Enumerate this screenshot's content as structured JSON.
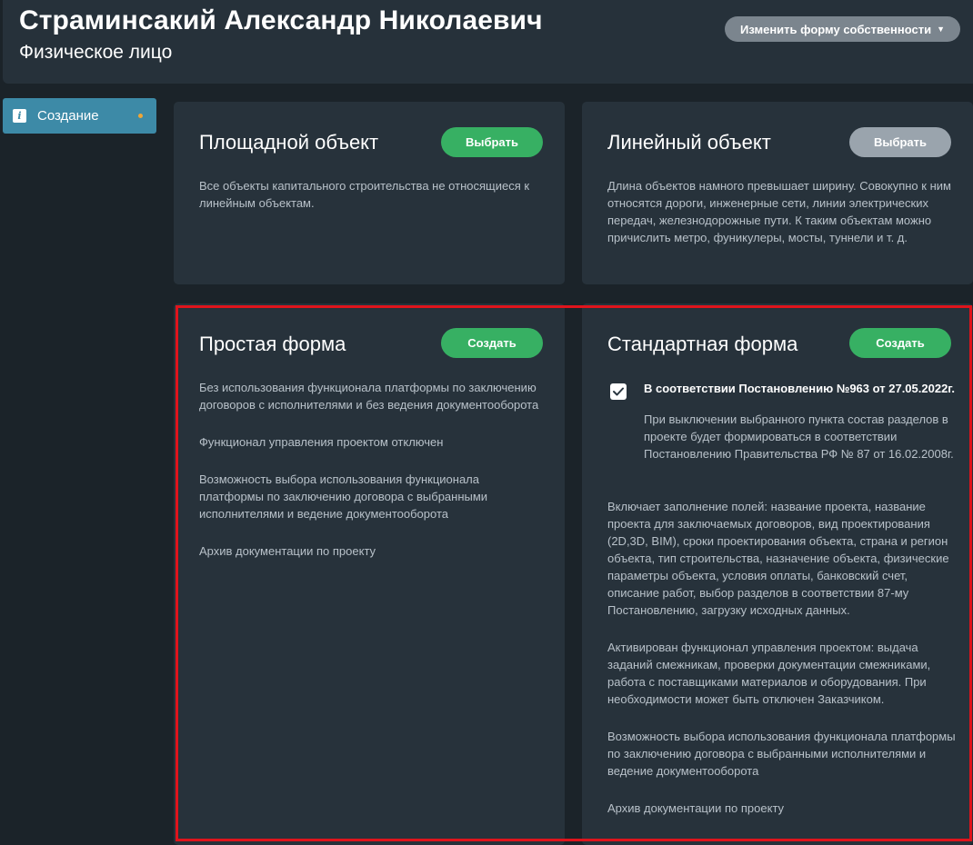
{
  "header": {
    "title": "Страминсакий Александр Николаевич",
    "subtitle": "Физическое лицо",
    "owner_button": "Изменить форму собственности"
  },
  "sidebar": {
    "items": [
      {
        "label": "Создание",
        "icon": "info-icon"
      }
    ]
  },
  "object_types": [
    {
      "title": "Площадной объект",
      "button": "Выбрать",
      "description": "Все объекты капитального строительства не относящиеся к линейным объектам."
    },
    {
      "title": "Линейный объект",
      "button": "Выбрать",
      "description": "Длина объектов намного превышает ширину. Совокупно к ним относятся дороги, инженерные сети, линии электрических передач, железнодорожные пути. К таким объектам можно причислить метро, фуникулеры, мосты, туннели и т. д."
    }
  ],
  "forms": {
    "simple": {
      "title": "Простая форма",
      "button": "Создать",
      "paragraphs": [
        "Без использования функционала платформы по заключению договоров с исполнителями и без ведения документооборота",
        "Функционал управления проектом отключен",
        "Возможность выбора использования функционала платформы по заключению договора с выбранными исполнителями и ведение документооборота",
        "Архив документации по проекту"
      ]
    },
    "standard": {
      "title": "Стандартная форма",
      "button": "Создать",
      "checkbox_label": "В соответствии Постановлению №963 от 27.05.2022г.",
      "checkbox_checked": true,
      "checkbox_note": "При выключении выбранного пункта состав разделов в проекте будет формироваться в соответствии Постановлению Правительства РФ № 87 от 16.02.2008г.",
      "paragraphs": [
        "Включает заполнение полей: название проекта, название проекта для заключаемых договоров, вид проектирования (2D,3D, BIM), сроки проектирования объекта, страна и регион объекта, тип строительства, назначение объекта, физические параметры объекта, условия оплаты, банковский счет, описание работ, выбор разделов в соответствии 87-му Постановлению, загрузку исходных данных.",
        "Активирован функционал управления проектом: выдача заданий смежникам, проверки документации смежниками, работа с поставщиками материалов и оборудования. При необходимости может быть отключен Заказчиком.",
        "Возможность выбора использования функционала платформы по заключению договора с выбранными исполнителями и ведение документооборота",
        "Архив документации по проекту"
      ]
    }
  },
  "colors": {
    "accent_green": "#37b063",
    "sidebar_active": "#3d8aa7",
    "highlight_border": "#e0141c"
  }
}
